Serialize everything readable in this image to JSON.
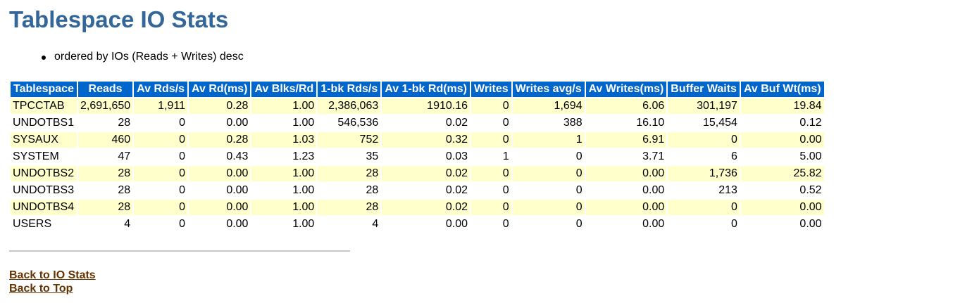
{
  "page": {
    "title": "Tablespace IO Stats",
    "notes": [
      "ordered by IOs (Reads + Writes) desc"
    ]
  },
  "table": {
    "headers": [
      "Tablespace",
      "Reads",
      "Av Rds/s",
      "Av Rd(ms)",
      "Av Blks/Rd",
      "1-bk Rds/s",
      "Av 1-bk Rd(ms)",
      "Writes",
      "Writes avg/s",
      "Av Writes(ms)",
      "Buffer Waits",
      "Av Buf Wt(ms)"
    ],
    "rows": [
      [
        "TPCCTAB",
        "2,691,650",
        "1,911",
        "0.28",
        "1.00",
        "2,386,063",
        "1910.16",
        "0",
        "1,694",
        "6.06",
        "301,197",
        "19.84"
      ],
      [
        "UNDOTBS1",
        "28",
        "0",
        "0.00",
        "1.00",
        "546,536",
        "0.02",
        "0",
        "388",
        "16.10",
        "15,454",
        "0.12"
      ],
      [
        "SYSAUX",
        "460",
        "0",
        "0.28",
        "1.03",
        "752",
        "0.32",
        "0",
        "1",
        "6.91",
        "0",
        "0.00"
      ],
      [
        "SYSTEM",
        "47",
        "0",
        "0.43",
        "1.23",
        "35",
        "0.03",
        "1",
        "0",
        "3.71",
        "6",
        "5.00"
      ],
      [
        "UNDOTBS2",
        "28",
        "0",
        "0.00",
        "1.00",
        "28",
        "0.02",
        "0",
        "0",
        "0.00",
        "1,736",
        "25.82"
      ],
      [
        "UNDOTBS3",
        "28",
        "0",
        "0.00",
        "1.00",
        "28",
        "0.02",
        "0",
        "0",
        "0.00",
        "213",
        "0.52"
      ],
      [
        "UNDOTBS4",
        "28",
        "0",
        "0.00",
        "1.00",
        "28",
        "0.02",
        "0",
        "0",
        "0.00",
        "0",
        "0.00"
      ],
      [
        "USERS",
        "4",
        "0",
        "0.00",
        "1.00",
        "4",
        "0.00",
        "0",
        "0",
        "0.00",
        "0",
        "0.00"
      ]
    ]
  },
  "links": {
    "back_to_io_stats": "Back to IO Stats",
    "back_to_top": "Back to Top"
  },
  "colors": {
    "title": "#336699",
    "header_bg": "#0066cc",
    "odd_row_bg": "#ffffcc",
    "link": "#663300"
  }
}
